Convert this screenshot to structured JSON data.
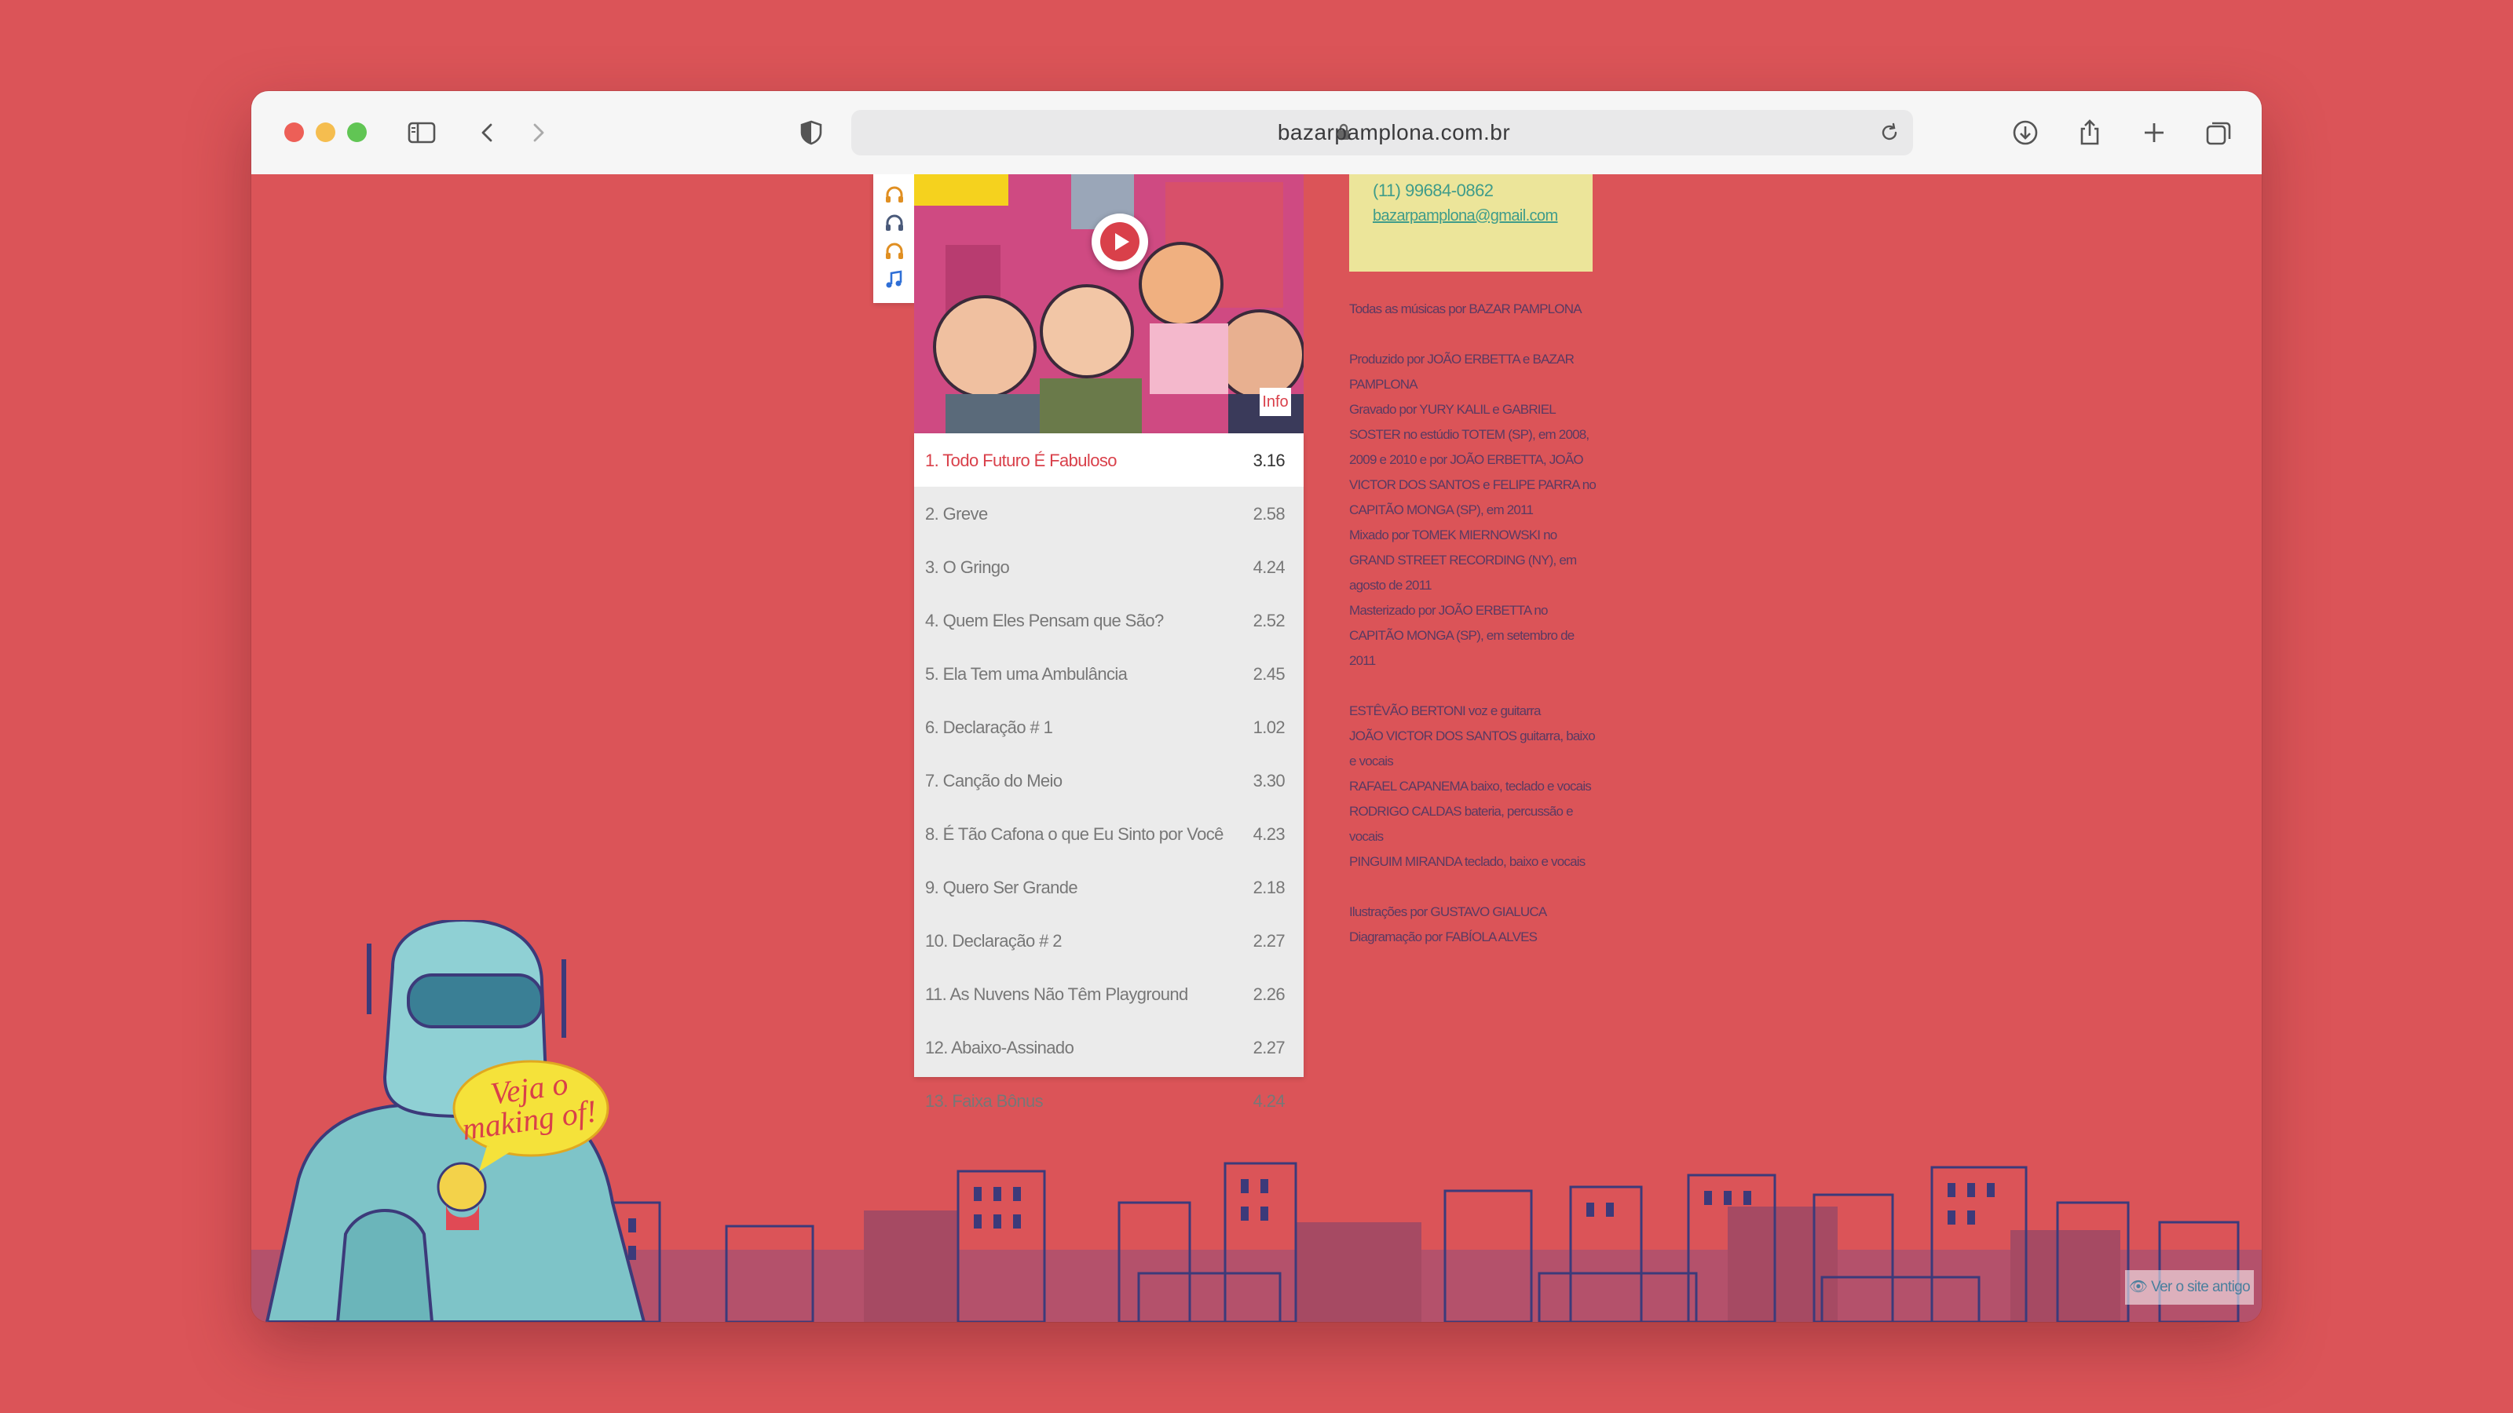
{
  "browser": {
    "url": "bazarpamplona.com.br",
    "traffic_lights": {
      "close": "#ed5f57",
      "minimize": "#f5bd4f",
      "zoom": "#61c554"
    }
  },
  "player": {
    "side_icons": [
      "headphones-icon",
      "headphones-icon",
      "headphones-icon",
      "music-note-icon"
    ],
    "info_label": "Info",
    "tracks": [
      {
        "num": "1.",
        "title": "Todo Futuro É Fabuloso",
        "duration": "3.16",
        "active": true
      },
      {
        "num": "2.",
        "title": "Greve",
        "duration": "2.58"
      },
      {
        "num": "3.",
        "title": "O Gringo",
        "duration": "4.24"
      },
      {
        "num": "4.",
        "title": "Quem Eles Pensam que São?",
        "duration": "2.52"
      },
      {
        "num": "5.",
        "title": "Ela Tem uma Ambulância",
        "duration": "2.45"
      },
      {
        "num": "6.",
        "title": "Declaração # 1",
        "duration": "1.02"
      },
      {
        "num": "7.",
        "title": "Canção do Meio",
        "duration": "3.30"
      },
      {
        "num": "8.",
        "title": "É Tão Cafona o que Eu Sinto por Você",
        "duration": "4.23"
      },
      {
        "num": "9.",
        "title": "Quero Ser Grande",
        "duration": "2.18"
      },
      {
        "num": "10.",
        "title": "Declaração # 2",
        "duration": "2.27"
      },
      {
        "num": "11.",
        "title": "As Nuvens Não Têm Playground",
        "duration": "2.26"
      },
      {
        "num": "12.",
        "title": "Abaixo-Assinado",
        "duration": "2.27"
      },
      {
        "num": "13.",
        "title": "Faixa Bônus",
        "duration": "4.24"
      }
    ]
  },
  "contact": {
    "phone": "(11) 99684-0862",
    "email": "bazarpamplona@gmail.com"
  },
  "credits": {
    "all_music": "Todas as músicas por BAZAR PAMPLONA",
    "produced": "Produzido por JOÃO ERBETTA e BAZAR PAMPLONA",
    "recorded": "Gravado por YURY KALIL e GABRIEL SOSTER no estúdio TOTEM (SP), em 2008, 2009 e 2010 e por JOÃO ERBETTA, JOÃO VICTOR DOS SANTOS e FELIPE PARRA no CAPITÃO MONGA (SP), em 2011",
    "mixed": "Mixado por TOMEK MIERNOWSKI no GRAND STREET RECORDING (NY), em agosto de 2011",
    "mastered": "Masterizado por JOÃO ERBETTA no CAPITÃO MONGA (SP), em setembro de 2011",
    "band": [
      "ESTÊVÃO BERTONI voz e guitarra",
      "JOÃO VICTOR DOS SANTOS guitarra, baixo e vocais",
      "RAFAEL CAPANEMA baixo, teclado e vocais",
      "RODRIGO CALDAS bateria, percussão e vocais",
      "PINGUIM MIRANDA teclado, baixo e vocais"
    ],
    "illustrations": "Ilustrações por GUSTAVO GIALUCA",
    "layout": "Diagramação por FABÍOLA ALVES"
  },
  "making_of": {
    "line1": "Veja o",
    "line2": "making of!"
  },
  "old_site_link": "Ver o site antigo"
}
